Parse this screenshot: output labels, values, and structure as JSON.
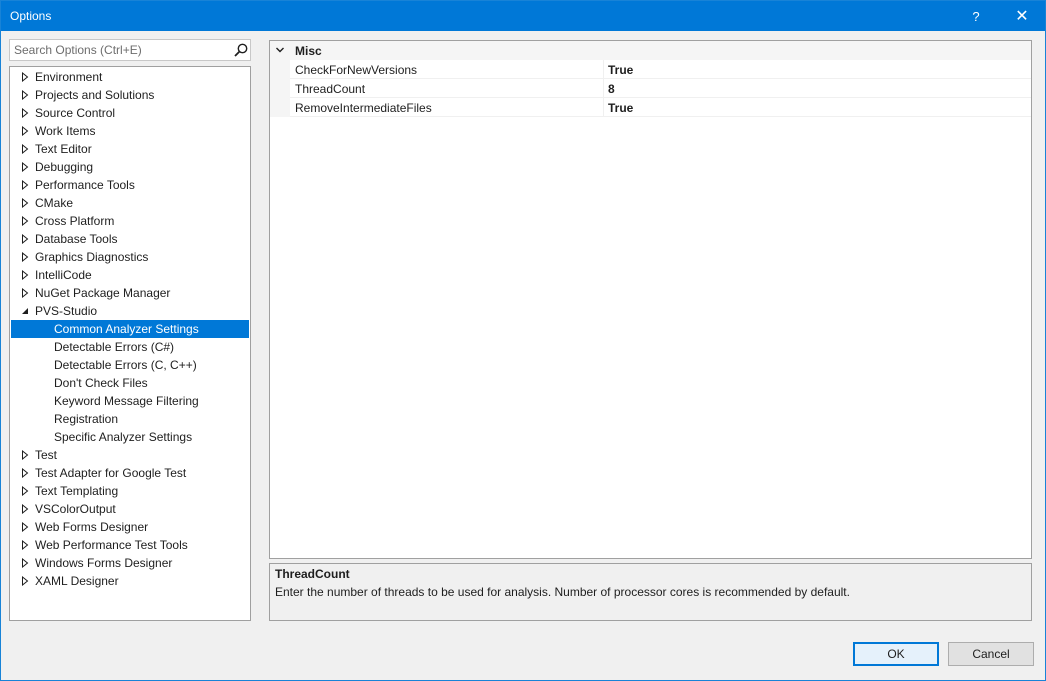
{
  "window": {
    "title": "Options",
    "help_glyph": "?",
    "close_glyph": "✕"
  },
  "search": {
    "placeholder": "Search Options (Ctrl+E)",
    "value": ""
  },
  "tree": {
    "items": [
      {
        "label": "Environment",
        "level": 0,
        "expander": "collapsed"
      },
      {
        "label": "Projects and Solutions",
        "level": 0,
        "expander": "collapsed"
      },
      {
        "label": "Source Control",
        "level": 0,
        "expander": "collapsed"
      },
      {
        "label": "Work Items",
        "level": 0,
        "expander": "collapsed"
      },
      {
        "label": "Text Editor",
        "level": 0,
        "expander": "collapsed"
      },
      {
        "label": "Debugging",
        "level": 0,
        "expander": "collapsed"
      },
      {
        "label": "Performance Tools",
        "level": 0,
        "expander": "collapsed"
      },
      {
        "label": "CMake",
        "level": 0,
        "expander": "collapsed"
      },
      {
        "label": "Cross Platform",
        "level": 0,
        "expander": "collapsed"
      },
      {
        "label": "Database Tools",
        "level": 0,
        "expander": "collapsed"
      },
      {
        "label": "Graphics Diagnostics",
        "level": 0,
        "expander": "collapsed"
      },
      {
        "label": "IntelliCode",
        "level": 0,
        "expander": "collapsed"
      },
      {
        "label": "NuGet Package Manager",
        "level": 0,
        "expander": "collapsed"
      },
      {
        "label": "PVS-Studio",
        "level": 0,
        "expander": "expanded"
      },
      {
        "label": "Common Analyzer Settings",
        "level": 1,
        "expander": "none",
        "selected": true
      },
      {
        "label": "Detectable Errors (C#)",
        "level": 1,
        "expander": "none"
      },
      {
        "label": "Detectable Errors (C, C++)",
        "level": 1,
        "expander": "none"
      },
      {
        "label": "Don't Check Files",
        "level": 1,
        "expander": "none"
      },
      {
        "label": "Keyword Message Filtering",
        "level": 1,
        "expander": "none"
      },
      {
        "label": "Registration",
        "level": 1,
        "expander": "none"
      },
      {
        "label": "Specific Analyzer Settings",
        "level": 1,
        "expander": "none"
      },
      {
        "label": "Test",
        "level": 0,
        "expander": "collapsed"
      },
      {
        "label": "Test Adapter for Google Test",
        "level": 0,
        "expander": "collapsed"
      },
      {
        "label": "Text Templating",
        "level": 0,
        "expander": "collapsed"
      },
      {
        "label": "VSColorOutput",
        "level": 0,
        "expander": "collapsed"
      },
      {
        "label": "Web Forms Designer",
        "level": 0,
        "expander": "collapsed"
      },
      {
        "label": "Web Performance Test Tools",
        "level": 0,
        "expander": "collapsed"
      },
      {
        "label": "Windows Forms Designer",
        "level": 0,
        "expander": "collapsed"
      },
      {
        "label": "XAML Designer",
        "level": 0,
        "expander": "collapsed"
      }
    ]
  },
  "property_grid": {
    "category": "Misc",
    "properties": [
      {
        "name": "CheckForNewVersions",
        "value": "True"
      },
      {
        "name": "ThreadCount",
        "value": "8"
      },
      {
        "name": "RemoveIntermediateFiles",
        "value": "True"
      }
    ]
  },
  "description": {
    "title": "ThreadCount",
    "text": "Enter the number of threads to be used for analysis. Number of processor cores is recommended by default."
  },
  "buttons": {
    "ok": "OK",
    "cancel": "Cancel"
  },
  "colors": {
    "accent": "#0078d7",
    "selection": "#0078d7"
  }
}
